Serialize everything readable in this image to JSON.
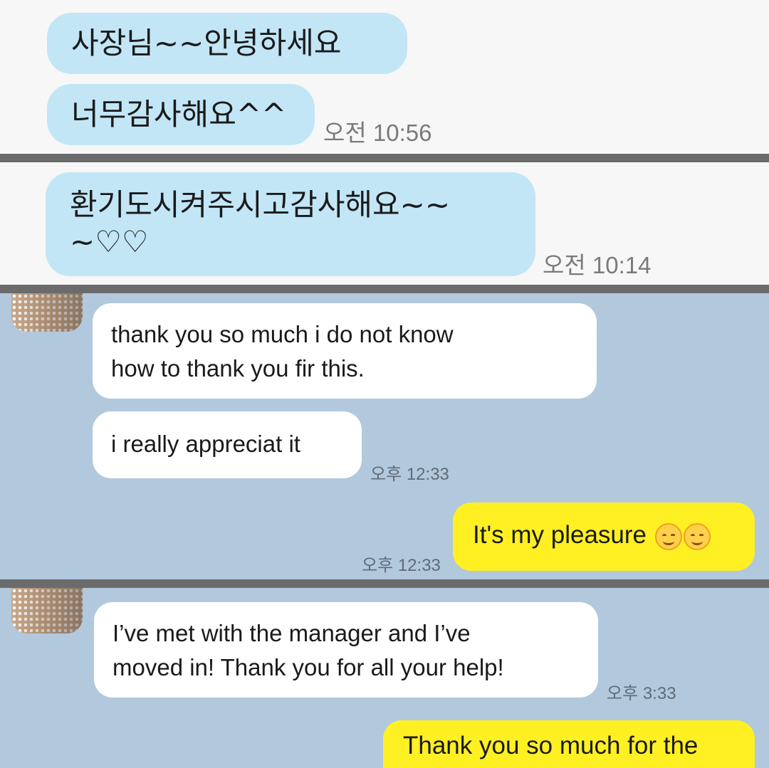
{
  "panel1": {
    "messages": [
      {
        "text": "사장님~~안녕하세요"
      },
      {
        "text": "너무감사해요^^"
      }
    ],
    "time": "오전 10:56"
  },
  "panel2": {
    "message_line1": "환기도시켜주시고감사해요~~",
    "message_line2": "~♡♡",
    "time": "오전 10:14"
  },
  "panel3": {
    "received": [
      {
        "line1": "thank you so much i do not know",
        "line2": "how to thank you fir this."
      },
      {
        "line1": "i really appreciat it"
      }
    ],
    "received_time": "오후 12:33",
    "sent": {
      "text": "It's my pleasure",
      "icons": [
        "smiling-face-icon",
        "smiling-face-icon"
      ]
    },
    "sent_time": "오후 12:33"
  },
  "panel4": {
    "received": {
      "line1": "I’ve met with the manager and I’ve",
      "line2": "moved in! Thank you for all your help!"
    },
    "received_time": "오후 3:33",
    "sent": {
      "text": "Thank you so much for the"
    }
  },
  "colors": {
    "divider": "#6b6b6b",
    "korean_bubble": "#c2e6f6",
    "chat_background": "#b2c8dd",
    "received_bubble": "#ffffff",
    "sent_bubble": "#fff023"
  }
}
